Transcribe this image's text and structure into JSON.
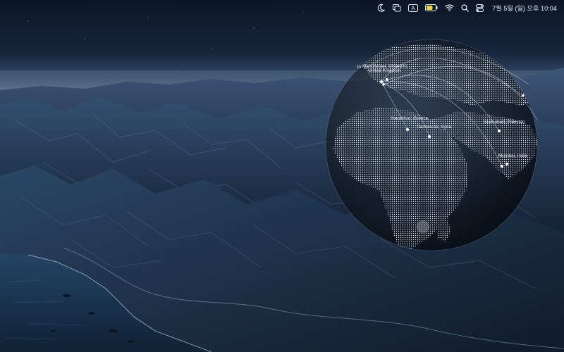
{
  "menubar": {
    "icons": [
      "crescent-moon-icon",
      "window-tiles-icon",
      "input-source-icon",
      "battery-icon",
      "wifi-icon",
      "search-icon",
      "control-center-icon"
    ],
    "input_source_letter": "A",
    "clock": "7월 5일 (일) 오후 10:04",
    "battery_level": 0.7
  },
  "globe": {
    "cities": [
      {
        "name": "Manchester, United Ki..."
      },
      {
        "name": "United Kingdom"
      },
      {
        "name": "Gr"
      },
      {
        "name": "Heraklion, Greece"
      },
      {
        "name": "Damascus, Syria"
      },
      {
        "name": "Islamabad, Pakistan"
      },
      {
        "name": "Mumbai, India"
      }
    ]
  },
  "colors": {
    "sky_top": "#0d1a2f",
    "sky_horizon": "#5a718c",
    "mountains": "#2a3d57",
    "ocean": "#1d3550",
    "globe_dots": "#d8e0ea",
    "connection_lines": "#aebfd3"
  }
}
